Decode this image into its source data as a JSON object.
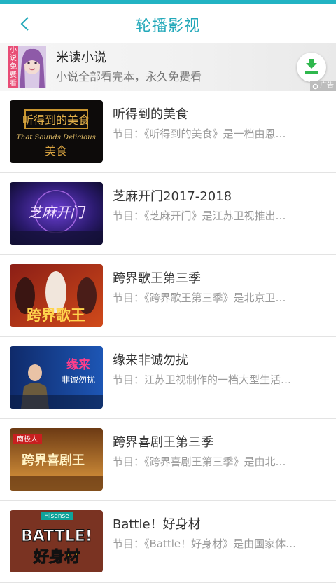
{
  "header": {
    "title": "轮播影视"
  },
  "ad": {
    "vertical_tag": "小说免费看",
    "title": "米读小说",
    "subtitle": "小说全部看完本，永久免费看",
    "mark": "广告"
  },
  "items": [
    {
      "name": "听得到的美食",
      "desc": "节目：《听得到的美食》是一档由恩…",
      "thumb_title": "听得到的美食",
      "thumb_sub": "That Sounds Delicious"
    },
    {
      "name": "芝麻开门2017-2018",
      "desc": "节目：《芝麻开门》是江苏卫视推出…",
      "thumb_title": "芝麻开门"
    },
    {
      "name": "跨界歌王第三季",
      "desc": "节目：《跨界歌王第三季》是北京卫…",
      "thumb_title": "跨界歌王"
    },
    {
      "name": "缘来非诚勿扰",
      "desc": "节目：江苏卫视制作的一档大型生活…",
      "thumb_title": "缘来",
      "thumb_sub": "非诚勿扰"
    },
    {
      "name": "跨界喜剧王第三季",
      "desc": "节目：《跨界喜剧王第三季》是由北…",
      "thumb_title": "跨界喜剧王",
      "thumb_sub": "南极人"
    },
    {
      "name": "Battle！好身材",
      "desc": "节目：《Battle！好身材》是由国家体…",
      "thumb_title": "好身材",
      "thumb_sub": "BATTLE!",
      "thumb_logo": "Hisense"
    }
  ]
}
